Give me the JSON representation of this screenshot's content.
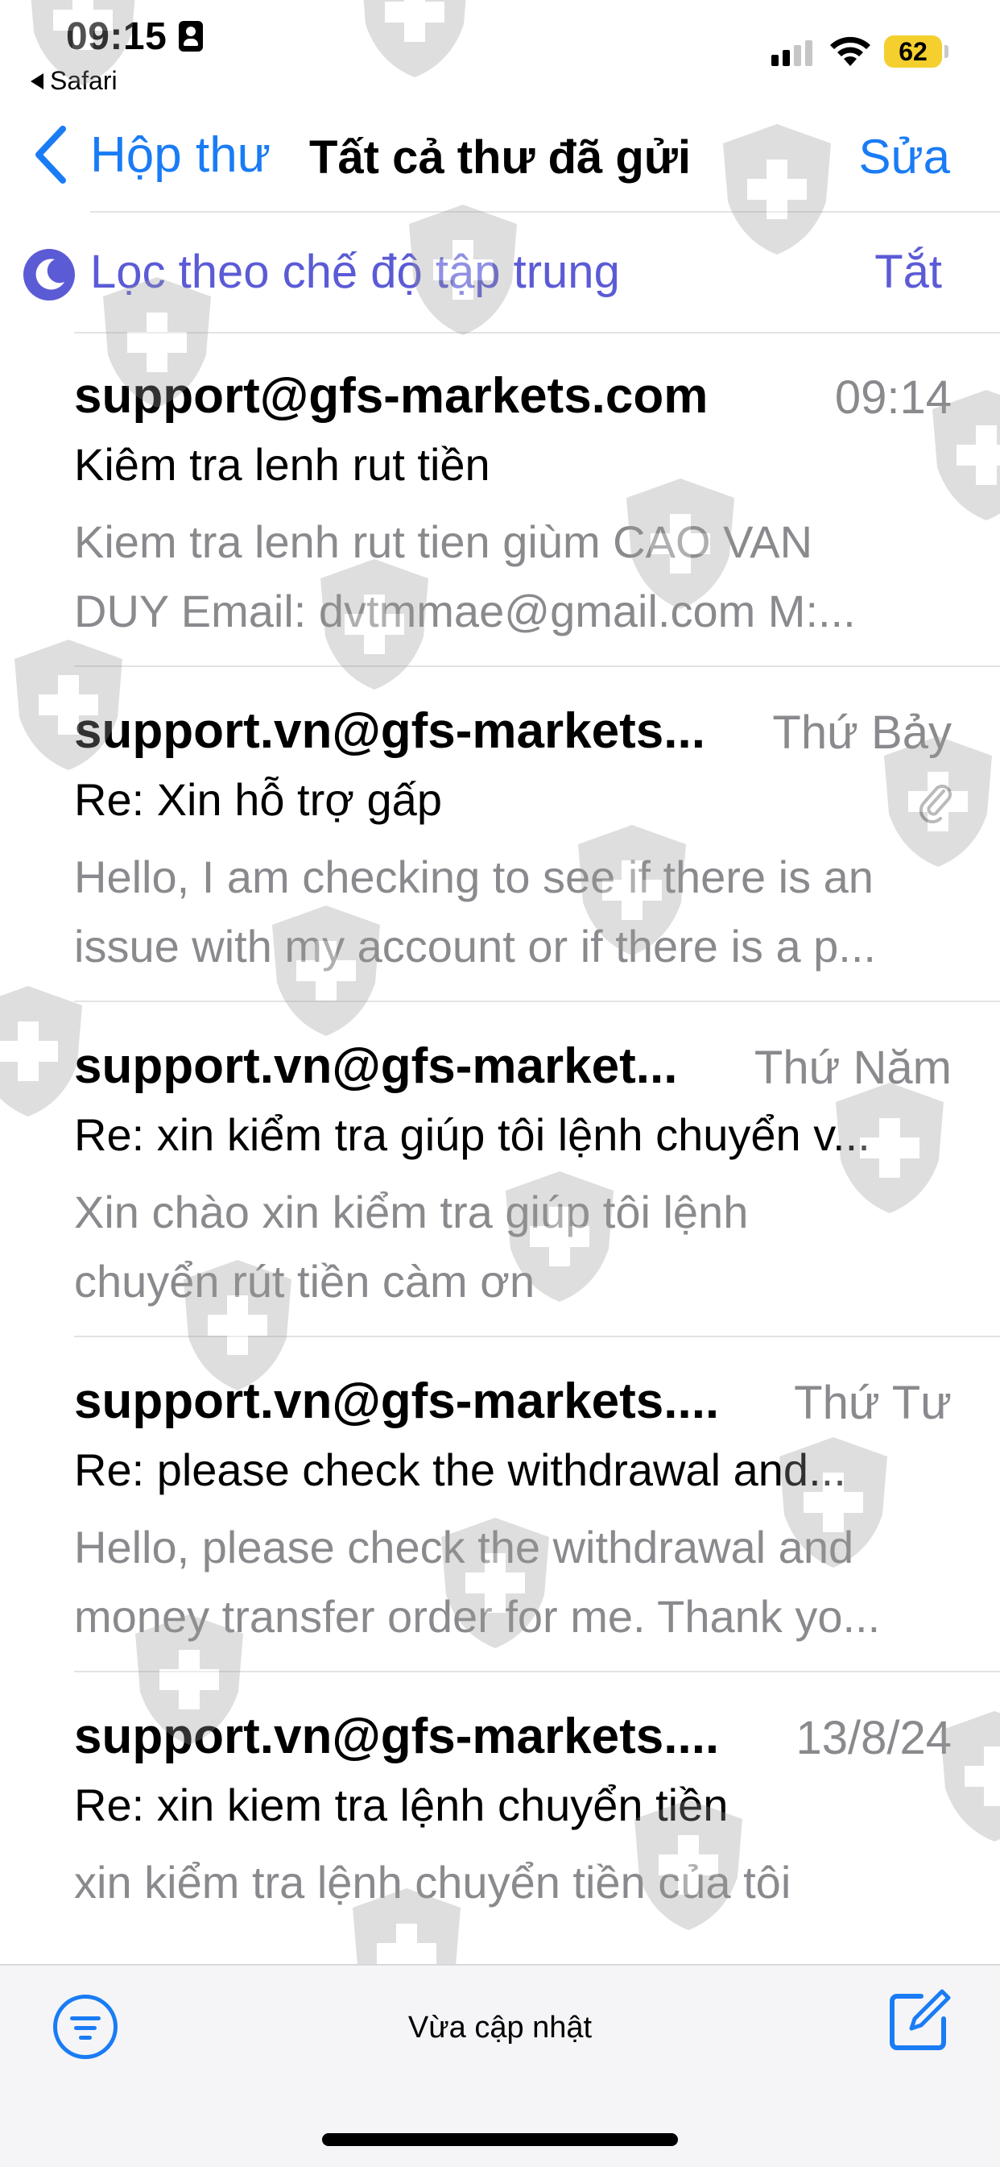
{
  "status_bar": {
    "time": "09:15",
    "back_app": "Safari",
    "battery": "62"
  },
  "nav": {
    "back_label": "Hộp thư",
    "title": "Tất cả thư đã gửi",
    "edit_label": "Sửa"
  },
  "focus_filter": {
    "label": "Lọc theo chế độ tập trung",
    "toggle_label": "Tắt"
  },
  "emails": [
    {
      "sender": "support@gfs-markets.com",
      "date": "09:14",
      "subject": "Kiêm tra lenh rut tiền",
      "preview_line1": "Kiem tra lenh rut tien giùm CAO VAN",
      "preview_line2": "DUY Email: dvtmmae@gmail.com M:..."
    },
    {
      "sender": "support.vn@gfs-markets...",
      "date": "Thứ Bảy",
      "subject": "Re: Xin hỗ trợ gấp",
      "preview_line1": "Hello, I am checking to see if there is an",
      "preview_line2": "issue with my account or if there is a p...",
      "has_attachment": true
    },
    {
      "sender": "support.vn@gfs-market...",
      "date": "Thứ Năm",
      "subject": "Re: xin kiểm tra giúp tôi lệnh chuyển v...",
      "preview_line1": "Xin chào xin kiểm tra giúp tôi lệnh",
      "preview_line2": "chuyển rút tiền càm ơn"
    },
    {
      "sender": "support.vn@gfs-markets....",
      "date": "Thứ Tư",
      "subject": "Re: please check the withdrawal and...",
      "preview_line1": "Hello, please check the withdrawal and",
      "preview_line2": "money transfer order for me. Thank yo..."
    },
    {
      "sender": "support.vn@gfs-markets....",
      "date": "13/8/24",
      "subject": "Re: xin kiem tra lệnh chuyển tiền",
      "preview_line1": "xin kiểm tra lệnh chuyển tiền của tôi",
      "preview_line2": ""
    }
  ],
  "toolbar": {
    "status_label": "Vừa cập nhật"
  },
  "icons": {
    "back": "chevron-left-icon",
    "focus": "moon-icon",
    "filter": "filter-icon",
    "compose": "compose-icon",
    "attachment": "paperclip-icon",
    "watermark": "shield-cross-icon"
  },
  "colors": {
    "accent": "#1a7cf5",
    "focus": "#5b5bd6",
    "secondary_text": "#8a8a8e",
    "battery": "#f5cf2d"
  }
}
